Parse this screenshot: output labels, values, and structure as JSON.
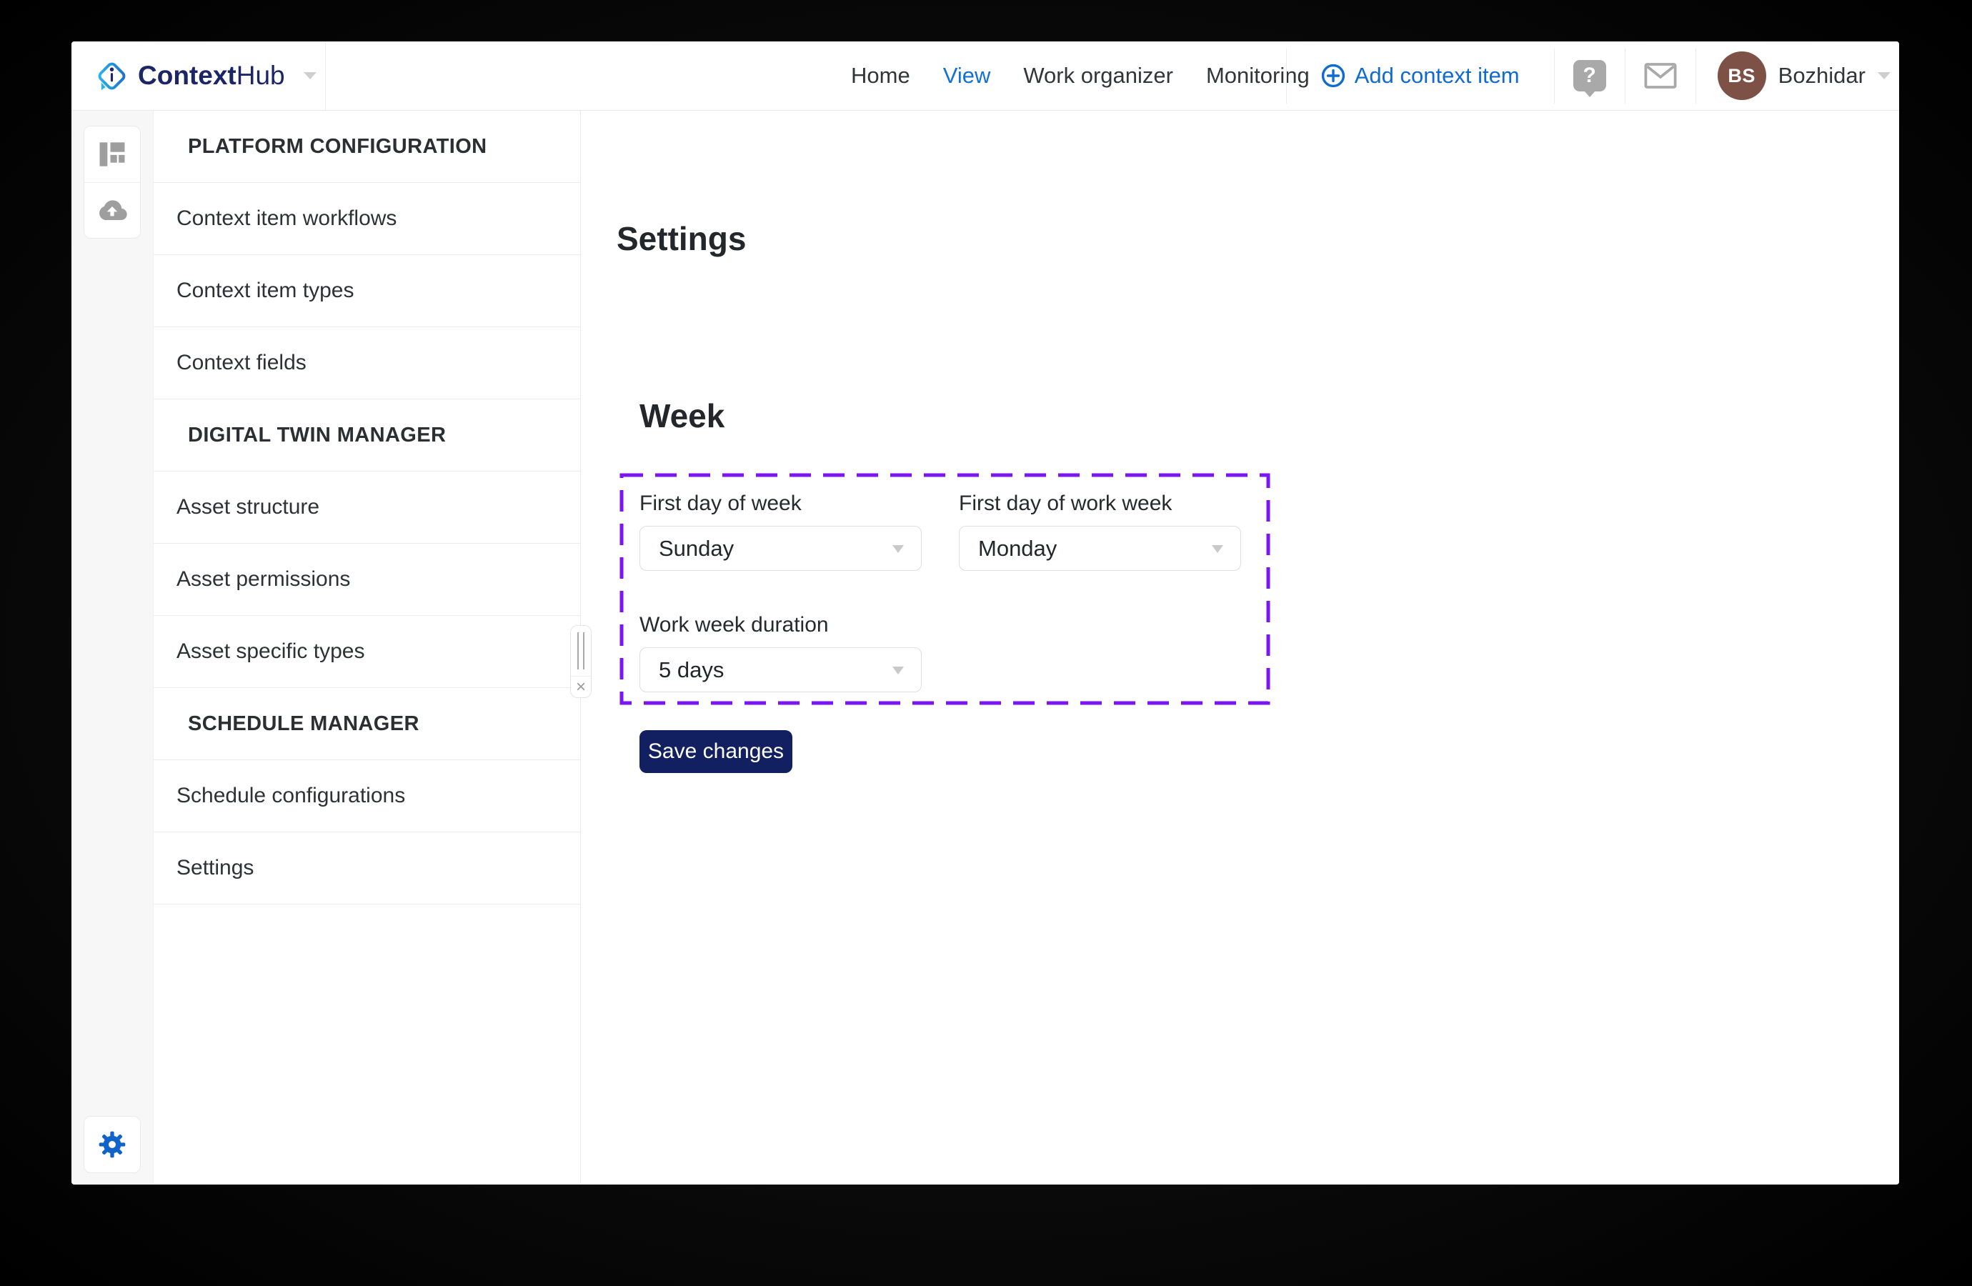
{
  "header": {
    "logo": {
      "brand_bold": "Context",
      "brand_light": "Hub"
    },
    "nav": [
      {
        "label": "Home",
        "active": false
      },
      {
        "label": "View",
        "active": true
      },
      {
        "label": "Work organizer",
        "active": false
      },
      {
        "label": "Monitoring",
        "active": false
      }
    ],
    "add_button": {
      "label": "Add context item"
    },
    "help_glyph": "?",
    "user": {
      "initials": "BS",
      "name": "Bozhidar"
    }
  },
  "sidebar": {
    "sections": [
      {
        "title": "PLATFORM CONFIGURATION",
        "items": [
          "Context item workflows",
          "Context item types",
          "Context fields"
        ]
      },
      {
        "title": "DIGITAL TWIN MANAGER",
        "items": [
          "Asset structure",
          "Asset permissions",
          "Asset specific types"
        ]
      },
      {
        "title": "SCHEDULE MANAGER",
        "items": [
          "Schedule configurations",
          "Settings"
        ]
      }
    ],
    "close_glyph": "×"
  },
  "main": {
    "page_title": "Settings",
    "section_title": "Week",
    "fields": [
      {
        "label": "First day of week",
        "value": "Sunday"
      },
      {
        "label": "First day of work week",
        "value": "Monday"
      },
      {
        "label": "Work week duration",
        "value": "5 days"
      }
    ],
    "save_label": "Save changes"
  },
  "colors": {
    "accent_blue": "#1272d4",
    "save_navy": "#121f60",
    "highlight_purple": "#7b16f2",
    "avatar_brown": "#7d5145",
    "logo_navy": "#1c2566"
  }
}
